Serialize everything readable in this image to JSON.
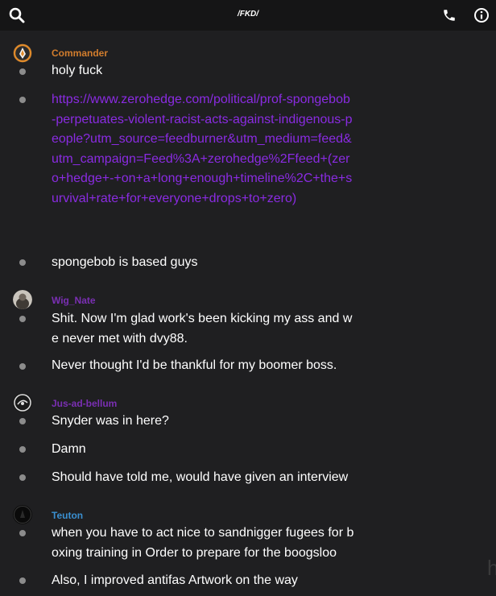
{
  "header": {
    "title": "/FKD/",
    "search_icon": "search-icon",
    "phone_icon": "phone-icon",
    "info_icon": "info-icon"
  },
  "colors": {
    "commander": "#d27d2d",
    "wig_nate": "#7a2fb3",
    "jus_ad_bellum": "#7a2fb3",
    "teuton": "#3a8fd0",
    "link": "#8a2be2"
  },
  "groups": [
    {
      "author": "Commander",
      "messages": [
        "holy fuck",
        "https://www.zerohedge.com/political/prof-spongebob-perpetuates-violent-racist-acts-against-indigenous-people?utm_source=feedburner&utm_medium=feed&utm_campaign=Feed%3A+zerohedge%2Ffeed+(zero+hedge+-+on+a+long+enough+timeline%2C+the+survival+rate+for+everyone+drops+to+zero)",
        "spongebob is based guys"
      ]
    },
    {
      "author": "Wig_Nate",
      "messages": [
        "Shit. Now I'm glad work's been kicking my ass and we never met with dvy88.",
        "Never thought I'd be thankful for my boomer boss."
      ]
    },
    {
      "author": "Jus-ad-bellum",
      "messages": [
        "Snyder was in here?",
        "Damn",
        "Should have told me, would have given an interview"
      ]
    },
    {
      "author": "Teuton",
      "messages": [
        "when you have to act nice to sandnigger fugees for boxing  training in Order to prepare for the boogsloo",
        "Also, I improved antifas Artwork on the way"
      ]
    }
  ]
}
